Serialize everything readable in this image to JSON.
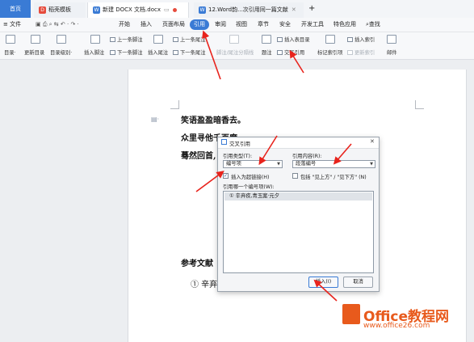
{
  "tabs": {
    "home": "首页",
    "template": "稻壳模板",
    "doc": "新建 DOCX 文档.docx",
    "doc2": "12.Word韵...次引用同一篇文献"
  },
  "menu": {
    "file": "文件",
    "items": [
      "开始",
      "插入",
      "页面布局",
      "引用",
      "审阅",
      "视图",
      "章节",
      "安全",
      "开发工具",
      "特色应用"
    ],
    "search": "查找"
  },
  "toolbar": {
    "toc": "目录·",
    "update_toc": "更新目录",
    "toc_level": "目录级别·",
    "insert_footnote": "插入脚注",
    "prev_footnote": "上一条脚注",
    "next_footnote": "下一条脚注",
    "insert_endnote": "插入尾注",
    "prev_endnote": "上一条尾注",
    "next_endnote": "下一条尾注",
    "note_convert": "脚注/尾注分隔线",
    "caption": "题注",
    "insert_table_toc": "插入表目录",
    "cross_ref": "交叉引用",
    "mark_index": "标记索引项",
    "insert_index": "插入索引",
    "update_index": "更新索引",
    "mail": "邮件"
  },
  "document": {
    "line1": "笑语盈盈暗香去。",
    "line2": "众里寻他千百度",
    "line3": "蓦然回首,",
    "ref_heading": "参考文献",
    "ref_item": "①  辛弃"
  },
  "dialog": {
    "title": "交叉引用",
    "ref_type_label": "引用类型(T):",
    "ref_type_value": "编号项",
    "ref_content_label": "引用内容(R):",
    "ref_content_value": "段落编号",
    "hyperlink_label": "插入为超链接(H)",
    "hyperlink_checked": true,
    "above_below_label": "包括 \"见上方\" / \"见下方\" (N)",
    "above_below_checked": false,
    "list_label": "引用哪一个编号项(W):",
    "list_items": [
      "①  辛弃疾,青玉案·元夕"
    ],
    "insert_button": "插入(I)",
    "cancel_button": "取消"
  },
  "watermark": {
    "title": "Office教程网",
    "url": "www.office26.com"
  },
  "colors": {
    "accent": "#3a7bd5",
    "annotation": "#e85a1c"
  }
}
